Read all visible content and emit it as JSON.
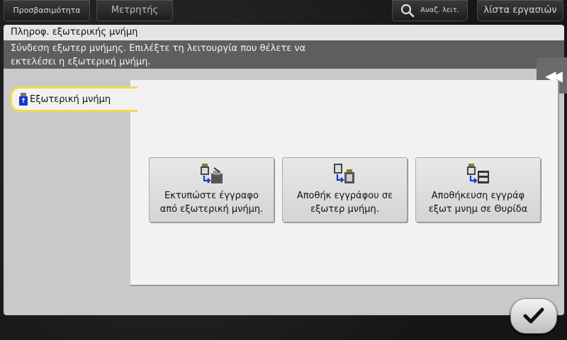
{
  "topbar": {
    "accessibility_label": "Προσβασιμότητα",
    "counter_label": "Μετρητής",
    "search_label": "Αναζ. λειτ.",
    "joblist_label": "λίστα εργασιών"
  },
  "panel": {
    "title": "Πληροφ. εξωτερικής μνήμη",
    "message_line1": "Σύνδεση εξωτερ μνήμης. Επιλέξτε τη λειτουργία που θέλετε να",
    "message_line2": "εκτελέσει η εξωτερική μνήμη."
  },
  "tab": {
    "label": "Εξωτερική μνήμη"
  },
  "functions": [
    {
      "line1": "Εκτυπώστε έγγραφο",
      "line2": "από εξωτερική μνήμη.",
      "icon": "usb-print-icon"
    },
    {
      "line1": "Αποθήκ εγγράφου σε",
      "line2": "εξωτερ μνήμη.",
      "icon": "usb-save-icon"
    },
    {
      "line1": "Αποθήκευση εγγράφ",
      "line2": "εξωτ μνημ σε Θυρίδα",
      "icon": "usb-box-icon"
    }
  ],
  "colors": {
    "tab_highlight": "#f0dc4a",
    "usb_blue": "#1a35c8"
  }
}
